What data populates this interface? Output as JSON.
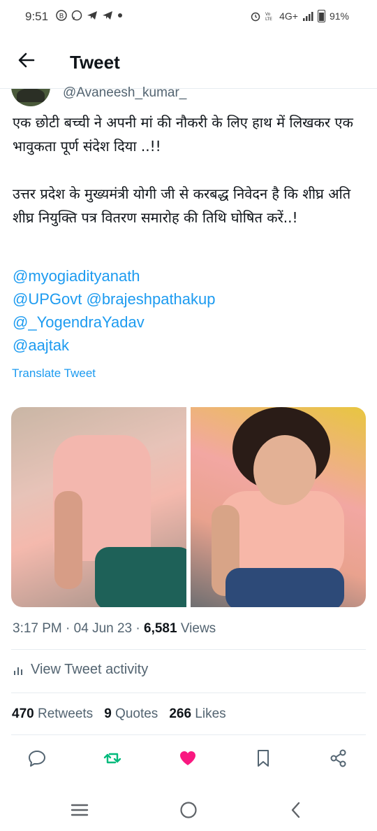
{
  "status_bar": {
    "time": "9:51",
    "battery": "91%",
    "network": "4G+"
  },
  "header": {
    "title": "Tweet"
  },
  "tweet": {
    "handle": "@Avaneesh_kumar_",
    "text_line1": "एक छोटी बच्ची ने अपनी मां की नौकरी के लिए हाथ में लिखकर एक भावुकता पूर्ण संदेश दिया ..!!",
    "text_line2": "उत्तर प्रदेश के मुख्यमंत्री योगी जी से करबद्ध निवेदन है कि शीघ्र अति शीघ्र नियुक्ति पत्र वितरण समारोह की तिथि घोषित करें..!",
    "mentions": [
      "@myogiadityanath",
      "@UPGovt",
      "@brajeshpathakup",
      "@_YogendraYadav",
      "@aajtak"
    ],
    "translate_label": "Translate Tweet",
    "time": "3:17 PM",
    "date": "04 Jun 23",
    "views_count": "6,581",
    "views_label": "Views"
  },
  "activity": {
    "label": "View Tweet activity"
  },
  "stats": {
    "retweets_count": "470",
    "retweets_label": "Retweets",
    "quotes_count": "9",
    "quotes_label": "Quotes",
    "likes_count": "266",
    "likes_label": "Likes"
  },
  "icons": {
    "back": "arrow-left-icon",
    "reply": "reply-icon",
    "retweet": "retweet-icon",
    "like": "heart-icon",
    "bookmark": "bookmark-icon",
    "share": "share-icon"
  },
  "colors": {
    "accent": "#1d9bf0",
    "retweet_active": "#00ba7c",
    "like_active": "#f91880",
    "text_secondary": "#536471"
  }
}
